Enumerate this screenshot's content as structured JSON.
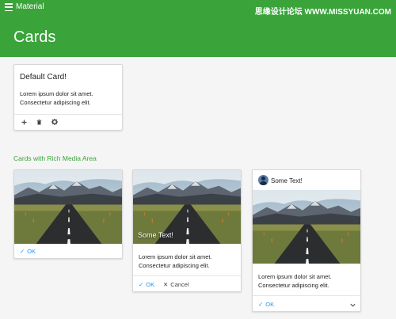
{
  "header": {
    "app_title": "Material",
    "page_title": "Cards",
    "watermark": "思缘设计论坛 WWW.MISSYUAN.COM",
    "menu_icon": "menu-icon",
    "bar_color": "#3aa43a"
  },
  "default_card": {
    "title": "Default Card!",
    "line1": "Lorem ipsum dolor sit amet.",
    "line2": "Consectetur adipiscing elit.",
    "actions": [
      {
        "icon": "add-icon",
        "glyph": "+"
      },
      {
        "icon": "trash-icon",
        "glyph": "🗑"
      },
      {
        "icon": "gear-icon",
        "glyph": "⚙"
      }
    ]
  },
  "section": {
    "title": "Cards with Rich Media Area"
  },
  "media_card_1": {
    "ok_label": "OK"
  },
  "media_card_2": {
    "overlay": "Some Text!",
    "line1": "Lorem ipsum dolor sit amet.",
    "line2": "Consectetur adipiscing elit.",
    "ok_label": "OK",
    "cancel_label": "Cancel"
  },
  "media_card_3": {
    "header_text": "Some Text!",
    "line1": "Lorem ipsum dolor sit amet.",
    "line2": "Consectetur adipiscing elit.",
    "ok_label": "OK"
  },
  "colors": {
    "accent": "#2196f3",
    "primary": "#3aa43a"
  }
}
